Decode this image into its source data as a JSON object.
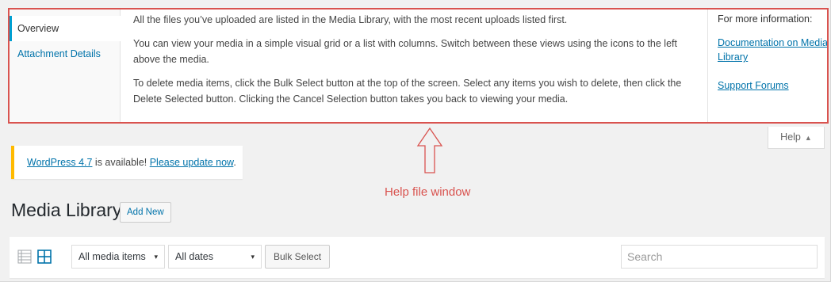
{
  "help_panel": {
    "tabs": [
      {
        "label": "Overview"
      },
      {
        "label": "Attachment Details"
      }
    ],
    "content": [
      "All the files you’ve uploaded are listed in the Media Library, with the most recent uploads listed first.",
      "You can view your media in a simple visual grid or a list with columns. Switch between these views using the icons to the left above the media.",
      "To delete media items, click the Bulk Select button at the top of the screen. Select any items you wish to delete, then click the Delete Selected button. Clicking the Cancel Selection button takes you back to viewing your media."
    ],
    "sidebar": {
      "title": "For more information:",
      "links": [
        {
          "label": "Documentation on Media Library"
        },
        {
          "label": "Support Forums"
        }
      ]
    }
  },
  "help_toggle": {
    "label": "Help",
    "caret": "▲"
  },
  "notice": {
    "version_link": "WordPress 4.7",
    "text": " is available! ",
    "update_link": "Please update now",
    "end": "."
  },
  "page": {
    "title": "Media Library",
    "add_new_label": "Add New"
  },
  "annotation": {
    "label": "Help file window",
    "color": "#d9534f"
  },
  "toolbar": {
    "view_icons": [
      "list-view-icon",
      "grid-view-icon"
    ],
    "media_filter": {
      "selected": "All media items",
      "caret": "▾"
    },
    "date_filter": {
      "selected": "All dates",
      "caret": "▾"
    },
    "bulk_select_label": "Bulk Select",
    "search": {
      "placeholder": "Search",
      "value": ""
    }
  },
  "colors": {
    "link": "#0073aa",
    "notice_accent": "#ffba00",
    "active_tab_accent": "#00a0d2",
    "grid_icon_active": "#0073aa"
  }
}
